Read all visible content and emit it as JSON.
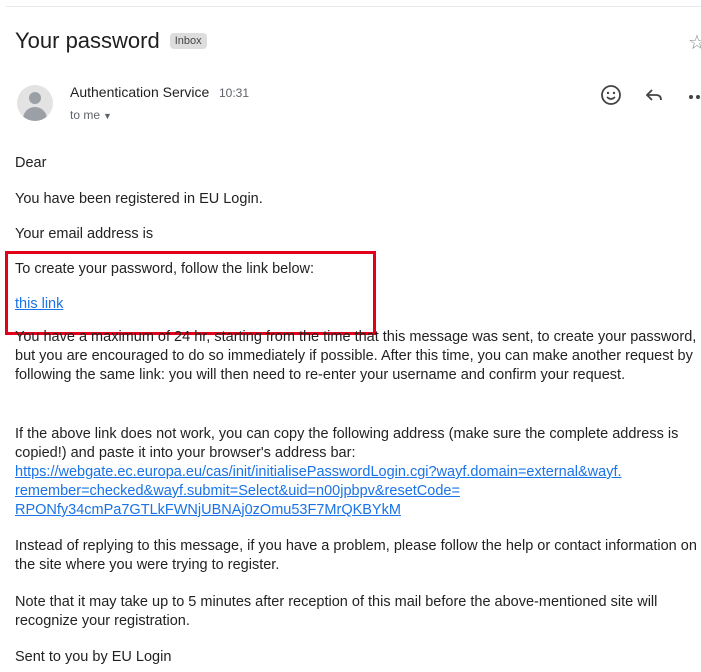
{
  "email": {
    "subject": "Your password",
    "badge": "Inbox",
    "sender": "Authentication Service",
    "time": "10:31",
    "recipient": "to me",
    "icons": {
      "star": "star-outline-icon",
      "emoji": "emoji-reaction-icon",
      "reply": "reply-arrow-icon",
      "more": "more-options-icon",
      "avatar": "default-avatar-icon"
    }
  },
  "body": {
    "greeting": "Dear",
    "registered": "You have been registered in EU Login.",
    "email_address": "Your email address is",
    "instruction": "To create your password, follow the link below:",
    "link_text": "this link",
    "maximum_time": "You have a maximum of 24 hr, starting from the time that this message was sent, to create your password, but you are encouraged to do so immediately if possible. After this time, you can make another request by following the same link: you will then need to re-enter your username and confirm your request.",
    "fallback": "If the above link does not work, you can copy the following address (make sure the complete address is copied!) and paste it into your browser's address bar:",
    "url_line1": "https://webgate.ec.europa.eu/cas/init/initialisePasswordLogin.cgi?wayf.domain=external&wayf.",
    "url_line2": "remember=checked&wayf.submit=Select&uid=n00jpbpv&resetCode=",
    "url_line3": "RPONfy34cmPa7GTLkFWNjUBNAj0zOmu53F7MrQKBYkM",
    "help": "Instead of replying to this message, if you have a problem, please follow the help or contact information on the site where you were trying to register.",
    "delay_note": "Note that it may take up to 5 minutes after reception of this mail before the above-mentioned site will recognize your registration.",
    "signature": "Sent to you by EU Login"
  },
  "colors": {
    "link": "#1a73e8",
    "highlight_border": "#e3001b"
  }
}
